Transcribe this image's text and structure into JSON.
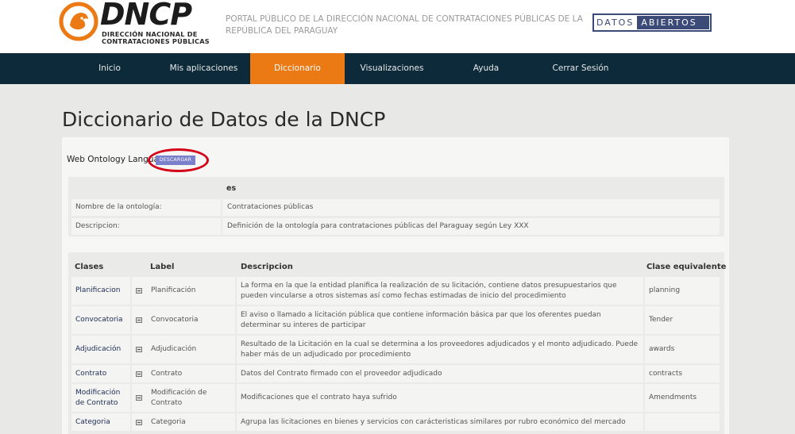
{
  "header": {
    "logo_text": "DNCP",
    "logo_sub_1": "DIRECCIÓN NACIONAL DE",
    "logo_sub_2": "CONTRATACIONES PÚBLICAS",
    "portal_text": "PORTAL PÚBLICO DE LA DIRECCIÓN NACIONAL DE CONTRATACIONES PÚBLICAS DE LA REPÚBLICA DEL PARAGUAY",
    "badge_left": "DATOS",
    "badge_right": "ABIERTOS"
  },
  "nav": {
    "items": [
      "Inicio",
      "Mis aplicaciones",
      "Diccionario",
      "Visualizaciones",
      "Ayuda",
      "Cerrar Sesión"
    ],
    "active": "Diccionario"
  },
  "page": {
    "title": "Diccionario de Datos de la DNCP",
    "owl_label": "Web Ontology Language",
    "download_label": "DESCARGAR"
  },
  "ontology": {
    "lang": "es",
    "rows": [
      {
        "label": "Nombre de la ontología:",
        "value": "Contrataciones públicas"
      },
      {
        "label": "Descripcion:",
        "value": "Definición de la ontología para contrataciones públicas del Paraguay según Ley XXX"
      }
    ]
  },
  "classes": {
    "headers": {
      "clases": "Clases",
      "label": "Label",
      "descripcion": "Descripcion",
      "equivalente": "Clase equivalente"
    },
    "rows": [
      {
        "clase": "Planificacion",
        "label": "Planificación",
        "descripcion": "La forma en la que la entidad planifica la realización de su licitación, contiene datos presupuestarios que pueden vincularse a otros sistemas así como fechas estimadas de inicio del procedimiento",
        "equivalente": "planning"
      },
      {
        "clase": "Convocatoria",
        "label": "Convocatoria",
        "descripcion": "El aviso o llamado a licitación pública que contiene información básica par que los oferentes puedan determinar su interes de participar",
        "equivalente": "Tender"
      },
      {
        "clase": "Adjudicación",
        "label": "Adjudicación",
        "descripcion": "Resultado de la Licitación en la cual se determina a los proveedores adjudicados y el monto adjudicado. Puede haber más de un adjudicado por procedimiento",
        "equivalente": "awards"
      },
      {
        "clase": "Contrato",
        "label": "Contrato",
        "descripcion": "Datos del Contrato firmado con el proveedor adjudicado",
        "equivalente": "contracts"
      },
      {
        "clase": "Modificación de Contrato",
        "label": "Modificación de Contrato",
        "descripcion": "Modificaciones que el contrato haya sufrido",
        "equivalente": "Amendments"
      },
      {
        "clase": "Categoria",
        "label": "Categoria",
        "descripcion": "Agrupa las licitaciones en bienes y servicios con carácteristicas similares por rubro económico del mercado",
        "equivalente": ""
      }
    ]
  },
  "colors": {
    "nav_bg": "#0c2a3a",
    "nav_active": "#ec7a14",
    "logo_orange": "#ec7a14",
    "badge_blue": "#3b4a77",
    "download_btn": "#7a80c9",
    "highlight_ring": "#d40018"
  }
}
